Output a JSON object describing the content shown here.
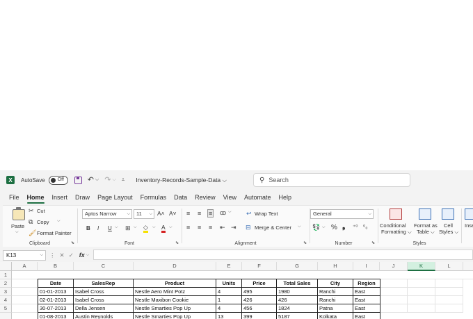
{
  "titlebar": {
    "app_icon": "X",
    "autosave_label": "AutoSave",
    "autosave_state": "Off",
    "doc_title": "Inventory-Records-Sample-Data",
    "doc_title_arrow": "⌵",
    "search_placeholder": "Search"
  },
  "tabs": [
    "File",
    "Home",
    "Insert",
    "Draw",
    "Page Layout",
    "Formulas",
    "Data",
    "Review",
    "View",
    "Automate",
    "Help"
  ],
  "ribbon": {
    "clipboard": {
      "paste": "Paste",
      "cut": "Cut",
      "copy": "Copy",
      "format_painter": "Format Painter",
      "label": "Clipboard"
    },
    "font": {
      "name": "Aptos Narrow",
      "size": "11",
      "grow": "A˄",
      "shrink": "A˅",
      "bold": "B",
      "italic": "I",
      "underline": "U",
      "label": "Font"
    },
    "alignment": {
      "wrap": "Wrap Text",
      "merge": "Merge & Center",
      "label": "Alignment"
    },
    "number": {
      "format": "General",
      "percent": "%",
      "comma": "❟",
      "label": "Number"
    },
    "styles": {
      "cond1": "Conditional",
      "cond2": "Formatting",
      "fmt1": "Format as",
      "fmt2": "Table",
      "cell1": "Cell",
      "cell2": "Styles",
      "label": "Styles"
    },
    "cells": {
      "insert": "Inse"
    }
  },
  "formula_bar": {
    "name_box": "K13",
    "fx": "fx",
    "value": ""
  },
  "columns": [
    "A",
    "B",
    "C",
    "D",
    "E",
    "F",
    "G",
    "H",
    "I",
    "J",
    "K",
    "L"
  ],
  "rows": [
    "1",
    "2",
    "3",
    "4",
    "5"
  ],
  "selected_column": "K",
  "table": {
    "headers": [
      "Date",
      "SalesRep",
      "Product",
      "Units",
      "Price",
      "Total Sales",
      "City",
      "Region"
    ],
    "rows": [
      [
        "01-01-2013",
        "Isabel Cross",
        "Nestle Aero Mint Potz",
        "4",
        "495",
        "1980",
        "Ranchi",
        "East"
      ],
      [
        "02-01-2013",
        "Isabel Cross",
        "Nestle Maxibon Cookie",
        "1",
        "426",
        "426",
        "Ranchi",
        "East"
      ],
      [
        "30-07-2013",
        "Della Jensen",
        "Nestle Smarties Pop Up",
        "4",
        "456",
        "1824",
        "Patna",
        "East"
      ],
      [
        "01-08-2013",
        "Austin Reynolds",
        "Nestle Smarties Pop Up",
        "13",
        "399",
        "5187",
        "Kolkata",
        "East"
      ]
    ]
  },
  "colors": {
    "accent": "#1d6f42",
    "ribbon_bg": "#f3f3f3"
  }
}
